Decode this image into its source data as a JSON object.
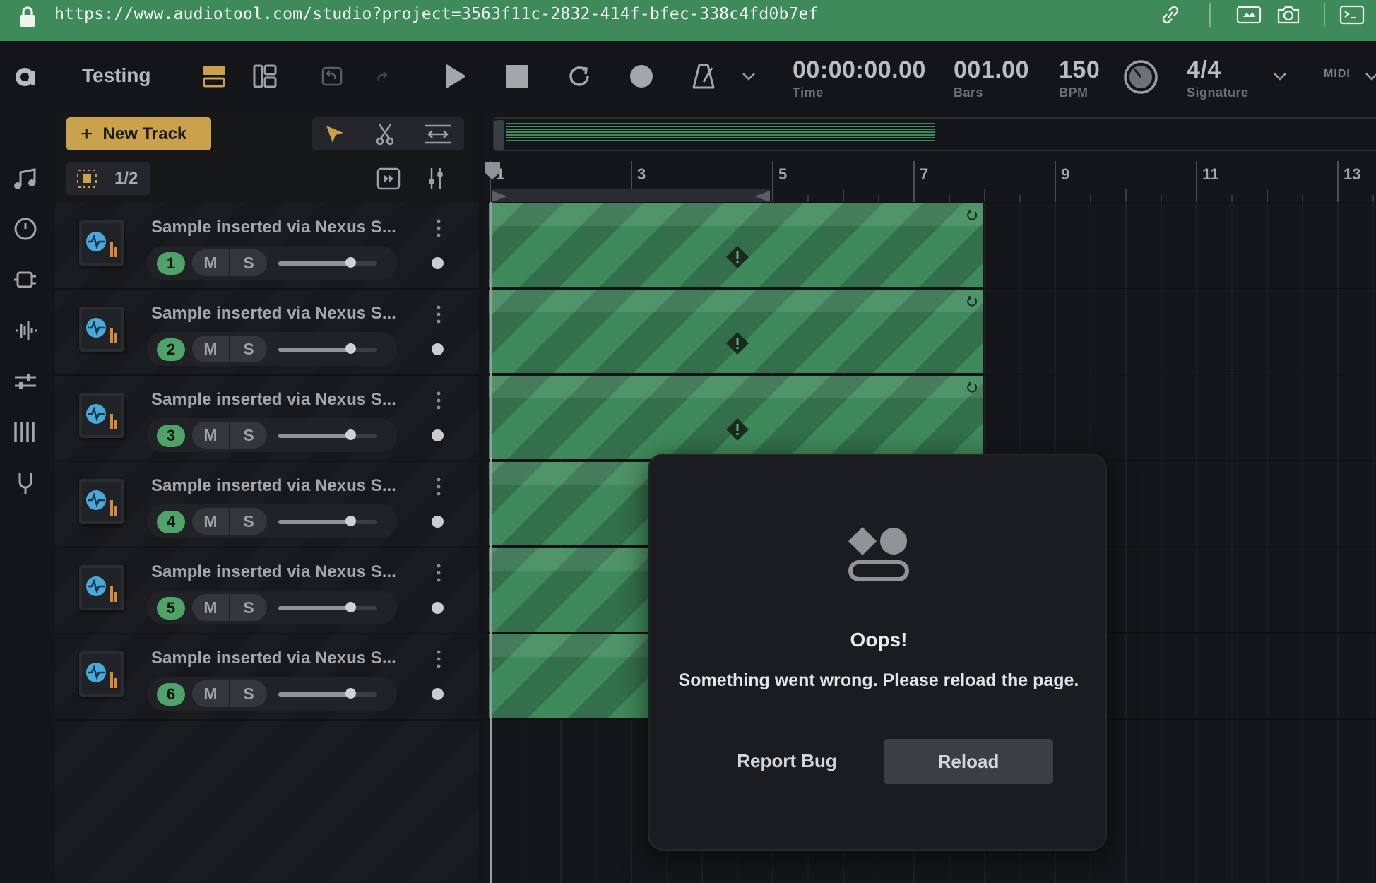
{
  "browser": {
    "url": "https://www.audiotool.com/studio?project=3563f11c-2832-414f-bfec-338c4fd0b7ef"
  },
  "toolbar": {
    "project_name": "Testing",
    "time_value": "00:00:00.00",
    "time_label": "Time",
    "bars_value": "001.00",
    "bars_label": "Bars",
    "bpm_value": "150",
    "bpm_label": "BPM",
    "signature_value": "4/4",
    "signature_label": "Signature",
    "midi_label": "MIDI"
  },
  "panel": {
    "new_track_label": "New Track",
    "zoom_label": "1/2"
  },
  "tracks": [
    {
      "number": "1",
      "title": "Sample inserted via Nexus S...",
      "mute": "M",
      "solo": "S",
      "volume": 0.73
    },
    {
      "number": "2",
      "title": "Sample inserted via Nexus S...",
      "mute": "M",
      "solo": "S",
      "volume": 0.73
    },
    {
      "number": "3",
      "title": "Sample inserted via Nexus S...",
      "mute": "M",
      "solo": "S",
      "volume": 0.73
    },
    {
      "number": "4",
      "title": "Sample inserted via Nexus S...",
      "mute": "M",
      "solo": "S",
      "volume": 0.73
    },
    {
      "number": "5",
      "title": "Sample inserted via Nexus S...",
      "mute": "M",
      "solo": "S",
      "volume": 0.73
    },
    {
      "number": "6",
      "title": "Sample inserted via Nexus S...",
      "mute": "M",
      "solo": "S",
      "volume": 0.73
    }
  ],
  "ruler": {
    "bar_labels": [
      "1",
      "3",
      "5",
      "7",
      "9",
      "11",
      "13"
    ]
  },
  "modal": {
    "title": "Oops!",
    "message": "Something went wrong. Please reload the page.",
    "report_label": "Report Bug",
    "reload_label": "Reload"
  },
  "colors": {
    "url_bar": "#3f8a5a",
    "accent_gold": "#caa14c",
    "track_green": "#4fa36a",
    "clip_green": "#3b7d55"
  }
}
